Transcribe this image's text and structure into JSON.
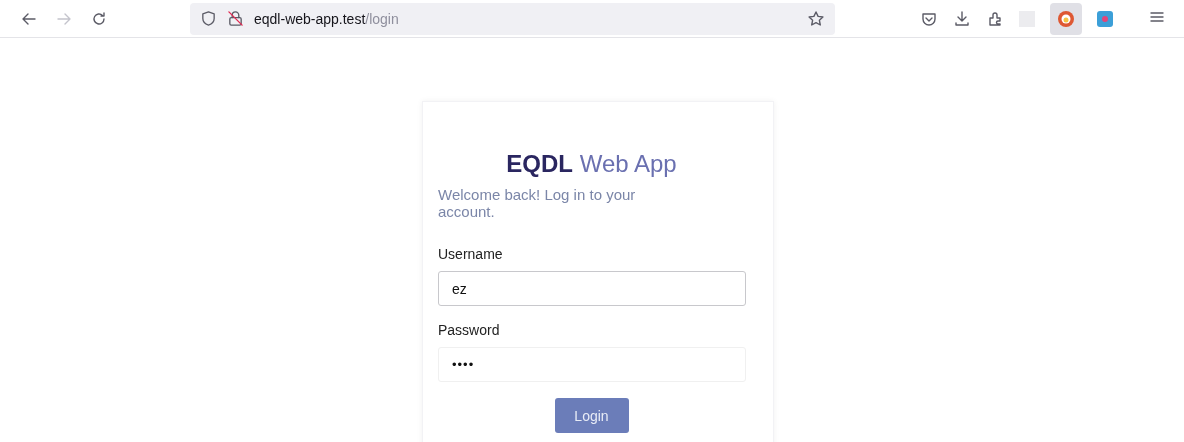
{
  "browser": {
    "url_host": "eqdl-web-app.test",
    "url_path": "/login",
    "forward_disabled": true
  },
  "login": {
    "brand": "EQDL",
    "brand_suffix": "Web App",
    "subtitle": "Welcome back! Log in to your account.",
    "fields": [
      {
        "label": "Username",
        "value": "ez",
        "focused": true
      },
      {
        "label": "Password",
        "value": "••••",
        "focused": false
      }
    ],
    "button": "Login"
  }
}
